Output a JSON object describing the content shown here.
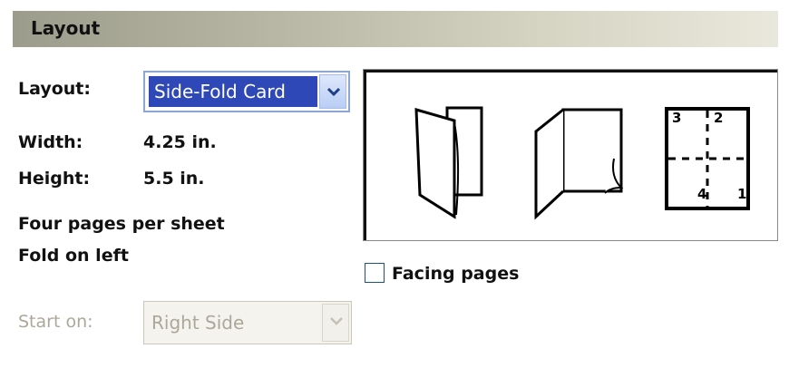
{
  "section": {
    "title": "Layout"
  },
  "layout": {
    "label": "Layout:",
    "selected": "Side-Fold Card"
  },
  "width": {
    "label": "Width:",
    "value": "4.25 in."
  },
  "height": {
    "label": "Height:",
    "value": "5.5 in."
  },
  "info": {
    "line1": "Four pages per sheet",
    "line2": "Fold on left"
  },
  "start": {
    "label": "Start on:",
    "selected": "Right Side",
    "enabled": false
  },
  "facing": {
    "label": "Facing pages",
    "checked": false
  },
  "preview": {
    "icons": [
      "folded-card-closed-icon",
      "folded-card-open-icon",
      "sheet-imposition-icon"
    ],
    "page_numbers": [
      "3",
      "2",
      "4",
      "1"
    ]
  },
  "colors": {
    "accent": "#2e48b8",
    "header": "#b8b7a5",
    "disabled": "#aca899"
  }
}
